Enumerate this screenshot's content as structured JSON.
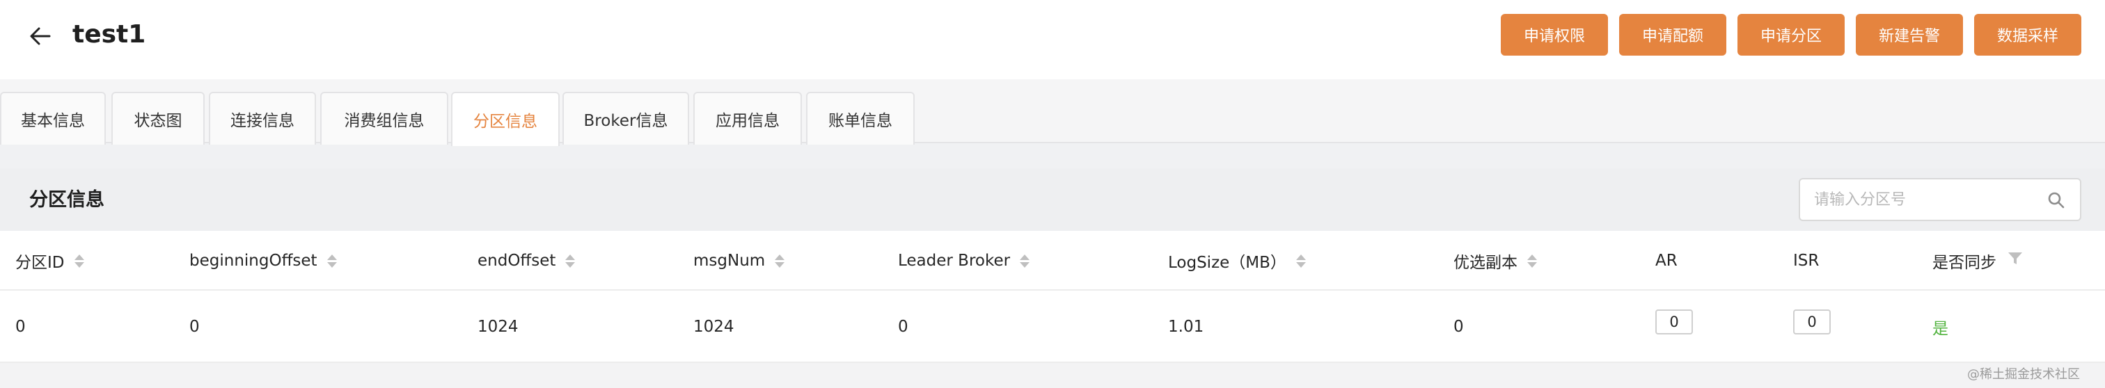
{
  "header": {
    "title": "test1",
    "actions": [
      "申请权限",
      "申请配额",
      "申请分区",
      "新建告警",
      "数据采样"
    ]
  },
  "tabs": [
    "基本信息",
    "状态图",
    "连接信息",
    "消费组信息",
    "分区信息",
    "Broker信息",
    "应用信息",
    "账单信息"
  ],
  "active_tab": "分区信息",
  "panel": {
    "title": "分区信息",
    "search_placeholder": "请输入分区号"
  },
  "table": {
    "columns": [
      "分区ID",
      "beginningOffset",
      "endOffset",
      "msgNum",
      "Leader Broker",
      "LogSize（MB）",
      "优选副本",
      "AR",
      "ISR",
      "是否同步"
    ],
    "rows": [
      [
        "0",
        "0",
        "1024",
        "1024",
        "0",
        "1.01",
        "0",
        "0",
        "0",
        "是"
      ]
    ]
  },
  "watermark": "@稀土掘金技术社区",
  "colors": {
    "accent": "#e5843f",
    "success": "#52b33f"
  }
}
